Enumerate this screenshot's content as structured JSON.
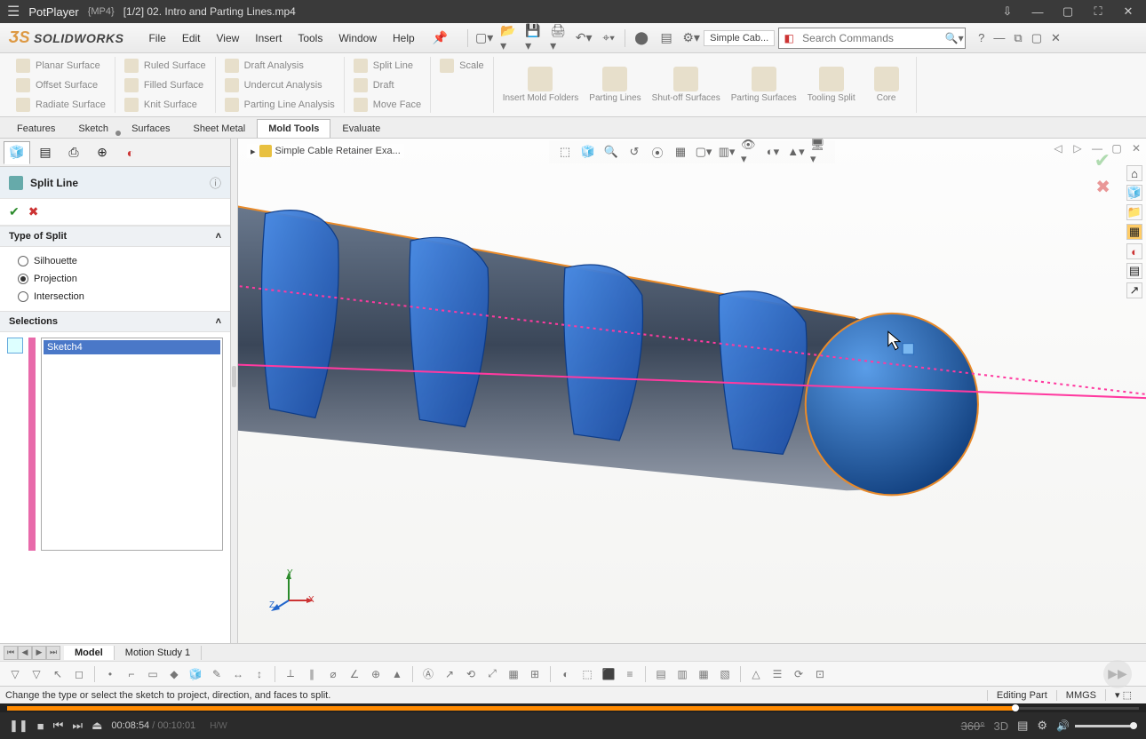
{
  "player": {
    "app_name": "PotPlayer",
    "format": "{MP4}",
    "file_title": "[1/2] 02. Intro and Parting Lines.mp4",
    "time_current": "00:08:54",
    "time_total": "00:10:01",
    "hw": "H/W",
    "right_labels": {
      "deg": "360°",
      "threeD": "3D"
    }
  },
  "sw": {
    "logo": "SOLIDWORKS",
    "menu": [
      "File",
      "Edit",
      "View",
      "Insert",
      "Tools",
      "Window",
      "Help"
    ],
    "doc_name": "Simple Cab...",
    "search_placeholder": "Search Commands",
    "help_label": "?",
    "ribbon": {
      "surfaces": [
        "Planar Surface",
        "Offset Surface",
        "Radiate Surface",
        "Ruled Surface",
        "Filled Surface",
        "Knit Surface"
      ],
      "analysis": [
        "Draft Analysis",
        "Undercut Analysis",
        "Parting Line Analysis"
      ],
      "split": [
        "Split Line",
        "Draft",
        "Move Face"
      ],
      "scale": "Scale",
      "big": [
        "Insert Mold Folders",
        "Parting Lines",
        "Shut-off Surfaces",
        "Parting Surfaces",
        "Tooling Split",
        "Core"
      ]
    },
    "tabs": [
      "Features",
      "Sketch",
      "Surfaces",
      "Sheet Metal",
      "Mold Tools",
      "Evaluate"
    ],
    "active_tab": "Mold Tools",
    "breadcrumb": "Simple Cable Retainer Exa...",
    "panel": {
      "title": "Split Line",
      "section1": "Type of Split",
      "options": [
        "Silhouette",
        "Projection",
        "Intersection"
      ],
      "selected_option": "Projection",
      "section2": "Selections",
      "selection_item": "Sketch4"
    },
    "bottom_tabs": [
      "Model",
      "Motion Study 1"
    ],
    "status": {
      "msg": "Change the type or select the sketch to project, direction, and faces to split.",
      "mode": "Editing Part",
      "units": "MMGS"
    },
    "triad": {
      "x": "X",
      "y": "Y",
      "z": "Z"
    }
  }
}
